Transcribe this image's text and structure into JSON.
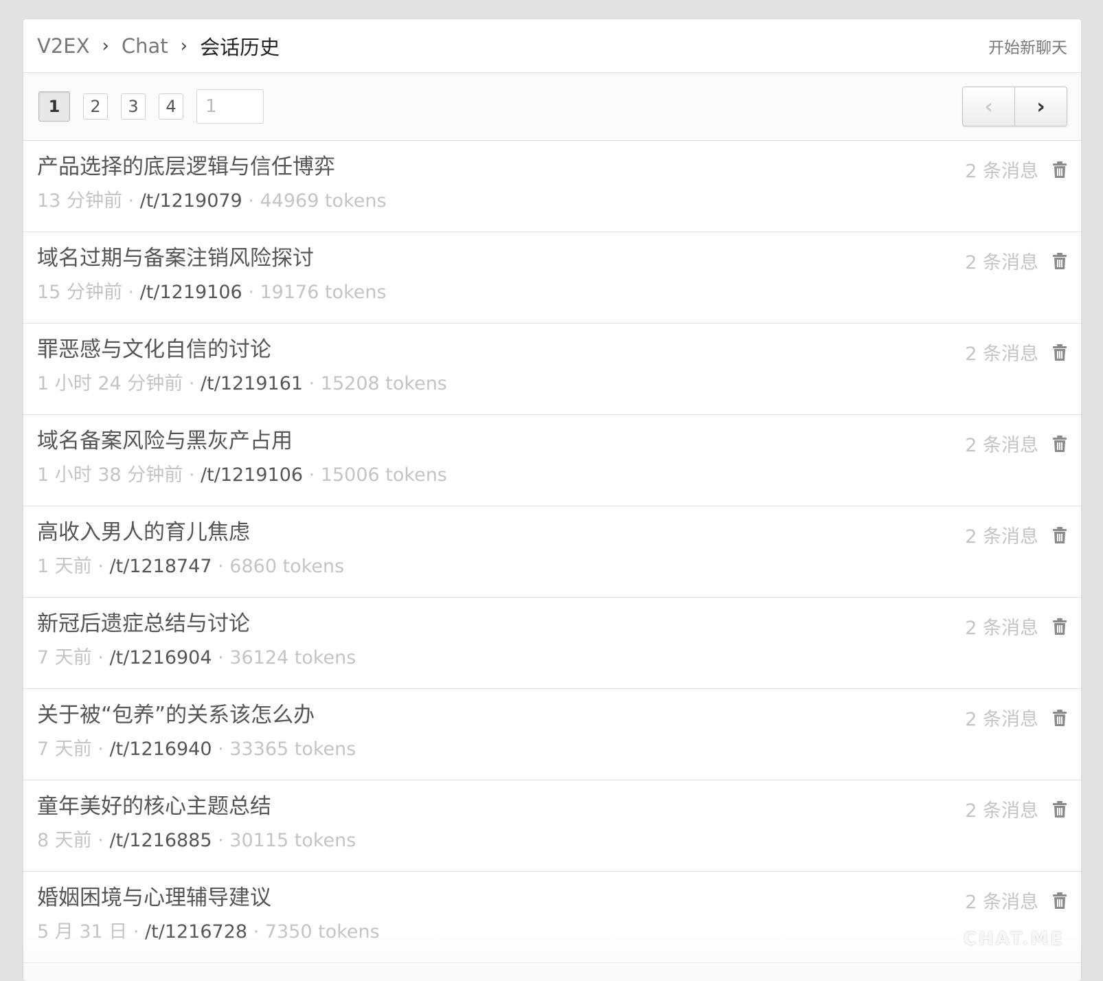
{
  "breadcrumb": {
    "site": "V2EX",
    "section": "Chat",
    "current": "会话历史",
    "separator": "›"
  },
  "header": {
    "new_chat_label": "开始新聊天"
  },
  "pagination": {
    "pages": [
      "1",
      "2",
      "3",
      "4"
    ],
    "current_page": "1",
    "input_value": "1",
    "prev_label": "‹",
    "next_label": "›"
  },
  "conversations": [
    {
      "title": "产品选择的底层逻辑与信任博弈",
      "time": "13 分钟前",
      "path": "/t/1219079",
      "tokens": "44969 tokens",
      "messages": "2 条消息"
    },
    {
      "title": "域名过期与备案注销风险探讨",
      "time": "15 分钟前",
      "path": "/t/1219106",
      "tokens": "19176 tokens",
      "messages": "2 条消息"
    },
    {
      "title": "罪恶感与文化自信的讨论",
      "time": "1 小时 24 分钟前",
      "path": "/t/1219161",
      "tokens": "15208 tokens",
      "messages": "2 条消息"
    },
    {
      "title": "域名备案风险与黑灰产占用",
      "time": "1 小时 38 分钟前",
      "path": "/t/1219106",
      "tokens": "15006 tokens",
      "messages": "2 条消息"
    },
    {
      "title": "高收入男人的育儿焦虑",
      "time": "1 天前",
      "path": "/t/1218747",
      "tokens": "6860 tokens",
      "messages": "2 条消息"
    },
    {
      "title": "新冠后遗症总结与讨论",
      "time": "7 天前",
      "path": "/t/1216904",
      "tokens": "36124 tokens",
      "messages": "2 条消息"
    },
    {
      "title": "关于被“包养”的关系该怎么办",
      "time": "7 天前",
      "path": "/t/1216940",
      "tokens": "33365 tokens",
      "messages": "2 条消息"
    },
    {
      "title": "童年美好的核心主题总结",
      "time": "8 天前",
      "path": "/t/1216885",
      "tokens": "30115 tokens",
      "messages": "2 条消息"
    },
    {
      "title": "婚姻困境与心理辅导建议",
      "time": "5 月 31 日",
      "path": "/t/1216728",
      "tokens": "7350 tokens",
      "messages": "2 条消息"
    }
  ],
  "meta_separator": " · ",
  "watermark": "CHAT.ME",
  "icons": {
    "delete": "trash-icon"
  },
  "colors": {
    "background": "#e2e2e2",
    "text_primary": "#555555",
    "text_muted": "#c4c4c4"
  }
}
